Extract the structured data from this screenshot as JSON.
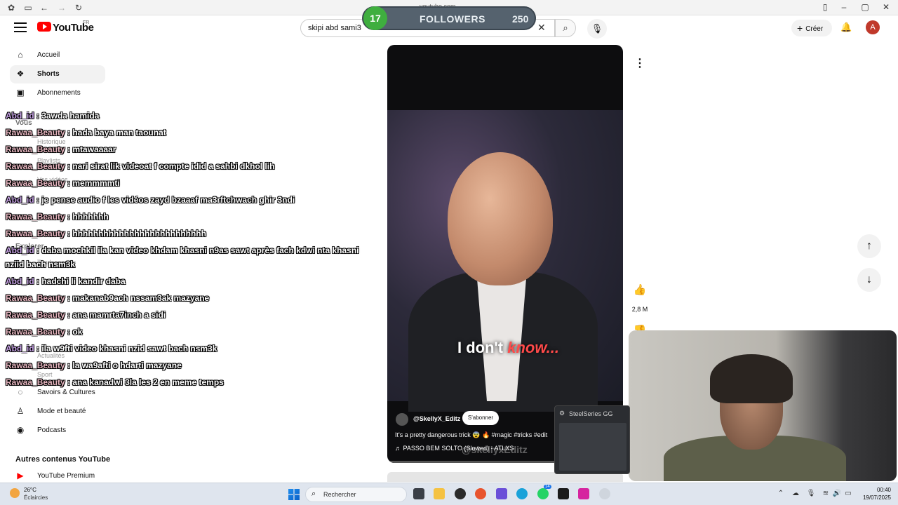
{
  "browser": {
    "url_hint": "youtube.com"
  },
  "header": {
    "logo_text": "YouTube",
    "region": "FR",
    "search_value": "skipi abd sami3",
    "create_label": "Créer",
    "avatar_letter": "A"
  },
  "followers_widget": {
    "count": "17",
    "label": "FOLLOWERS",
    "goal": "250"
  },
  "sidebar": {
    "items": [
      {
        "label": "Accueil",
        "icon": "home-icon"
      },
      {
        "label": "Shorts",
        "icon": "shorts-icon",
        "active": true
      },
      {
        "label": "Abonnements",
        "icon": "subscriptions-icon"
      }
    ],
    "you_label": "Vous",
    "you_items": [
      "Historique",
      "Playlists",
      "Vos vidéos"
    ],
    "explore_label": "Explorer",
    "explore_items": [
      "Tendances",
      "Actualités",
      "Sport"
    ],
    "lower_items": [
      {
        "label": "Savoirs & Cultures",
        "icon": "bulb-icon"
      },
      {
        "label": "Mode et beauté",
        "icon": "hanger-icon"
      },
      {
        "label": "Podcasts",
        "icon": "podcast-icon"
      }
    ],
    "more_section": "Autres contenus YouTube",
    "premium": "YouTube Premium"
  },
  "chat": [
    {
      "user": "Abd_id",
      "text": " : 3awda hamida"
    },
    {
      "user": "Rawaa_Beauty",
      "text": " : hada baya man taounat"
    },
    {
      "user": "Rawaa_Beauty",
      "text": " : mtawaaaar"
    },
    {
      "user": "Rawaa_Beauty",
      "text": " : nari sirat lik videoat f compte idid a sahbi dkhol lih"
    },
    {
      "user": "Rawaa_Beauty",
      "text": " : memmmmti"
    },
    {
      "user": "Abd_id",
      "text": " : je pense audio f les vidéos zayd bzaaaf ma3rftchwach ghir 3ndi"
    },
    {
      "user": "Rawaa_Beauty",
      "text": " : hhhhhhh"
    },
    {
      "user": "Rawaa_Beauty",
      "text": " : hhhhhhhhhhhhhhhhhhhhhhhhhh"
    },
    {
      "user": "Abd_id",
      "text": " : daba mochkil ila kan video khdam khasni n9as sawt après fach kdwi nta khasni",
      "cont": "nziid bach nsm3k"
    },
    {
      "user": "Abd_id",
      "text": " : hadchi li kandir daba"
    },
    {
      "user": "Rawaa_Beauty",
      "text": " : makanab9ach nssam3ak mazyane"
    },
    {
      "user": "Rawaa_Beauty",
      "text": " : ana mamrta7inch a sidi"
    },
    {
      "user": "Rawaa_Beauty",
      "text": " : ok"
    },
    {
      "user": "Abd_id",
      "text": " : ila w9fti video khasni nzid sawt bach nsm3k"
    },
    {
      "user": "Rawaa_Beauty",
      "text": " : la wa9afti o hdarti mazyane"
    },
    {
      "user": "Rawaa_Beauty",
      "text": " : ana kanadwi 3la les 2 en meme temps"
    }
  ],
  "video": {
    "caption_white": "I don't ",
    "caption_red": "know...",
    "watermark": "@skellyxEditz",
    "channel": "@SkellyX_Editz",
    "subscribe": "S'abonner",
    "title": "It's a pretty dangerous trick 😨 🔥 #magic #tricks #edit",
    "music": "♬ PASSO BEM SOLTO (Slowed) - ATLXS",
    "likes": "2,8 M"
  },
  "steelseries": {
    "title": "SteelSeries GG"
  },
  "taskbar": {
    "temp": "26°C",
    "weather": "Éclaircies",
    "search": "Rechercher",
    "time": "00:40",
    "date": "19/07/2025",
    "badge": "14"
  }
}
